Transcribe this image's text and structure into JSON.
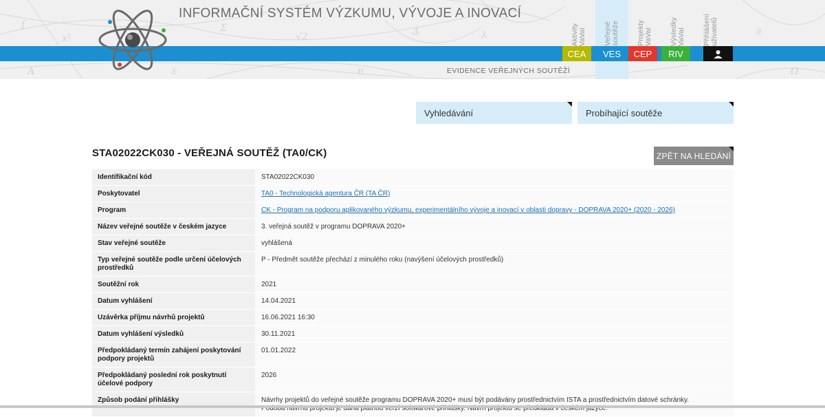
{
  "header": {
    "title": "INFORMAČNÍ SYSTÉM VÝZKUMU, VÝVOJE A INOVACÍ",
    "section_label": "EVIDENCE VEŘEJNÝCH SOUTĚŽÍ",
    "vertical_tabs": [
      {
        "label": "Aktivity\nVaVaI"
      },
      {
        "label": "Veřejné\nsoutěže"
      },
      {
        "label": "Projekty\nVaVaI"
      },
      {
        "label": "Výsledky\nVaVaI"
      },
      {
        "label": "Přihlášení\nuživatelů"
      }
    ],
    "color_tabs": [
      {
        "label": "CEA",
        "color": "#b7b900"
      },
      {
        "label": "VES",
        "color": "#1b8fd2"
      },
      {
        "label": "CEP",
        "color": "#e4362a"
      },
      {
        "label": "RIV",
        "color": "#3ab13a"
      }
    ],
    "user_icon": "user-icon",
    "brand_color": "#1b8fd2"
  },
  "nav": {
    "search": "Vyhledávání",
    "ongoing": "Probíhající soutěže"
  },
  "page": {
    "title": "STA02022CK030 - VEŘEJNÁ SOUTĚŽ (TA0/CK)",
    "back_button": "ZPĚT NA HLEDÁNÍ"
  },
  "details": [
    {
      "key": "Identifikační kód",
      "value": "STA02022CK030"
    },
    {
      "key": "Poskytovatel",
      "value": "TA0 - Technologická agentura ČR  (TA ČR)",
      "link": true
    },
    {
      "key": "Program",
      "value": "CK - Program na podporu aplikovaného výzkumu, experimentálního vývoje a inovací v oblasti dopravy - DOPRAVA 2020+  (2020 - 2026)",
      "link": true
    },
    {
      "key": "Název veřejné soutěže v českém jazyce",
      "value": "3. veřejná soutěž v programu DOPRAVA 2020+"
    },
    {
      "key": "Stav veřejné soutěže",
      "value": "vyhlášená"
    },
    {
      "key": "Typ veřejné soutěže podle určení účelových prostředků",
      "value": "P - Předmět soutěže přechází z minulého roku (navýšení účelových prostředků)"
    },
    {
      "key": "Soutěžní rok",
      "value": "2021"
    },
    {
      "key": "Datum vyhlášení",
      "value": "14.04.2021"
    },
    {
      "key": "Uzávěrka příjmu návrhů projektů",
      "value": "16.06.2021 16:30"
    },
    {
      "key": "Datum vyhlášení výsledků",
      "value": "30.11.2021"
    },
    {
      "key": "Předpokládaný termín zahájení poskytování podpory projektů",
      "value": "01.01.2022"
    },
    {
      "key": "Předpokládaný poslední rok poskytnutí účelové podpory",
      "value": "2026"
    },
    {
      "key": "Způsob podání přihlášky",
      "value": "Návrhy projektů do veřejné soutěže programu DOPRAVA 2020+ musí být podávány prostřednictvím ISTA a prostřednictvím datové schránky.",
      "value2": "Podoba návrhu projektu je dána platnou verzí softwarové přihlášky. Návrh projektu se předkládá v českém jazyce."
    }
  ]
}
